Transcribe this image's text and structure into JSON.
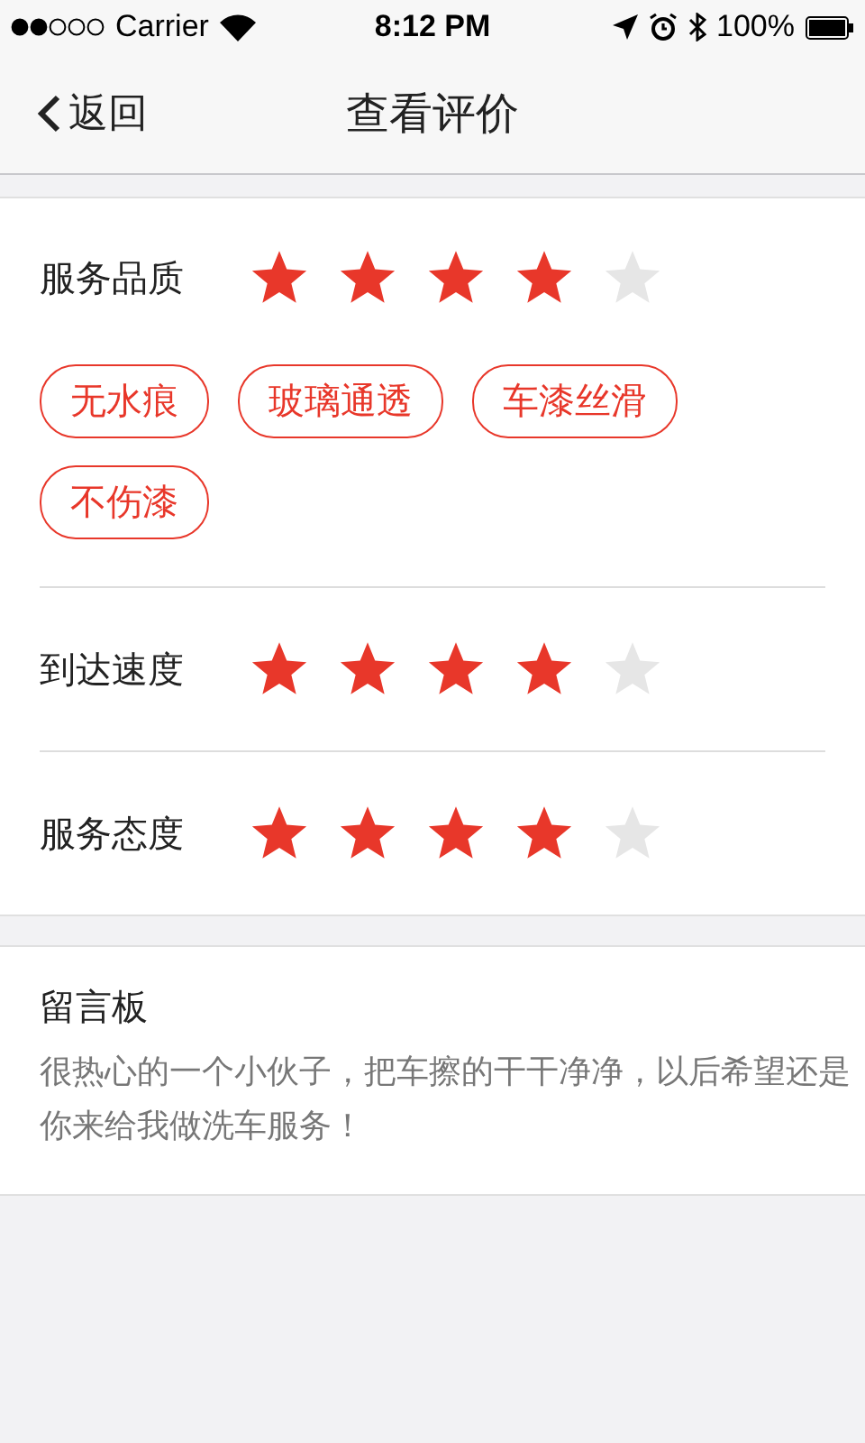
{
  "status_bar": {
    "carrier": "Carrier",
    "time": "8:12 PM",
    "battery": "100%"
  },
  "nav": {
    "back": "返回",
    "title": "查看评价"
  },
  "ratings": [
    {
      "label": "服务品质",
      "stars": 4,
      "tags": [
        "无水痕",
        "玻璃通透",
        "车漆丝滑",
        "不伤漆"
      ]
    },
    {
      "label": "到达速度",
      "stars": 4
    },
    {
      "label": "服务态度",
      "stars": 4
    }
  ],
  "message": {
    "title": "留言板",
    "text": "很热心的一个小伙子，把车擦的干干净净，以后希望还是你来给我做洗车服务！"
  }
}
